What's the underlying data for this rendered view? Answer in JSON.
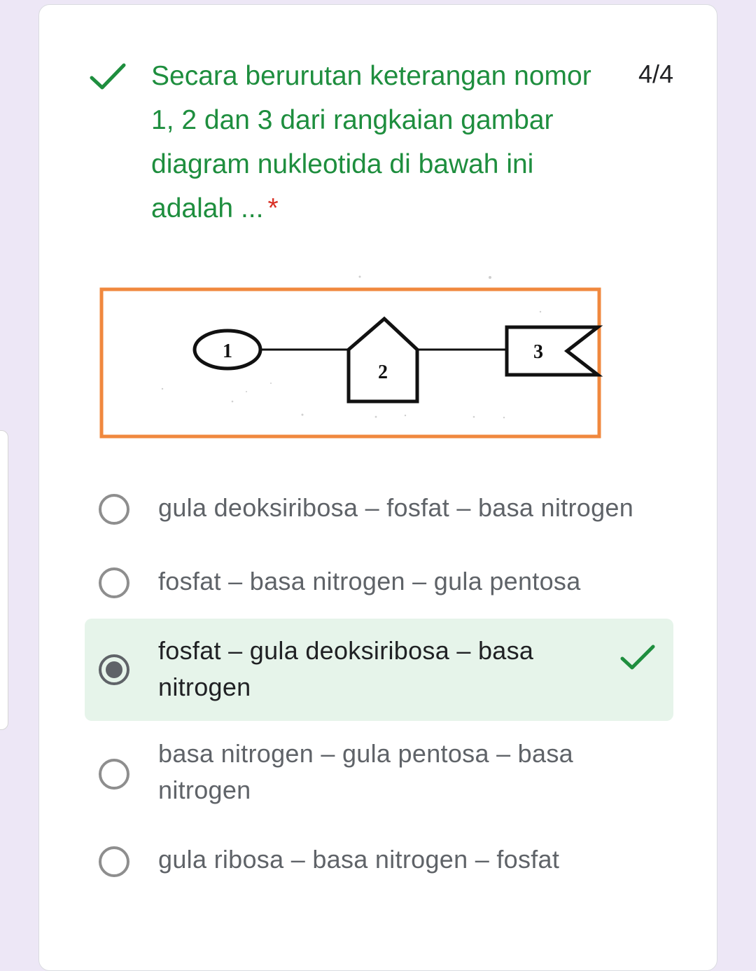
{
  "question": {
    "text": "Secara berurutan keterangan nomor 1, 2 dan 3 dari rangkaian gambar diagram nukleotida di bawah ini adalah ...",
    "required_marker": "*",
    "score": "4/4",
    "status": "correct",
    "check_icon": "check-icon"
  },
  "diagram": {
    "labels": [
      "1",
      "2",
      "3"
    ],
    "frame_color": "#f0883e"
  },
  "options": [
    {
      "label": "gula deoksiribosa – fosfat – basa nitrogen",
      "selected": false
    },
    {
      "label": "fosfat – basa nitrogen – gula pentosa",
      "selected": false
    },
    {
      "label": "fosfat – gula deoksiribosa – basa nitrogen",
      "selected": true,
      "correct": true
    },
    {
      "label": "basa nitrogen – gula pentosa – basa nitrogen",
      "selected": false
    },
    {
      "label": "gula ribosa – basa nitrogen – fosfat",
      "selected": false
    }
  ],
  "colors": {
    "correct": "#1e8e3e",
    "required": "#d93025",
    "selected_bg": "#e6f4ea",
    "page_bg": "#ede7f6"
  }
}
